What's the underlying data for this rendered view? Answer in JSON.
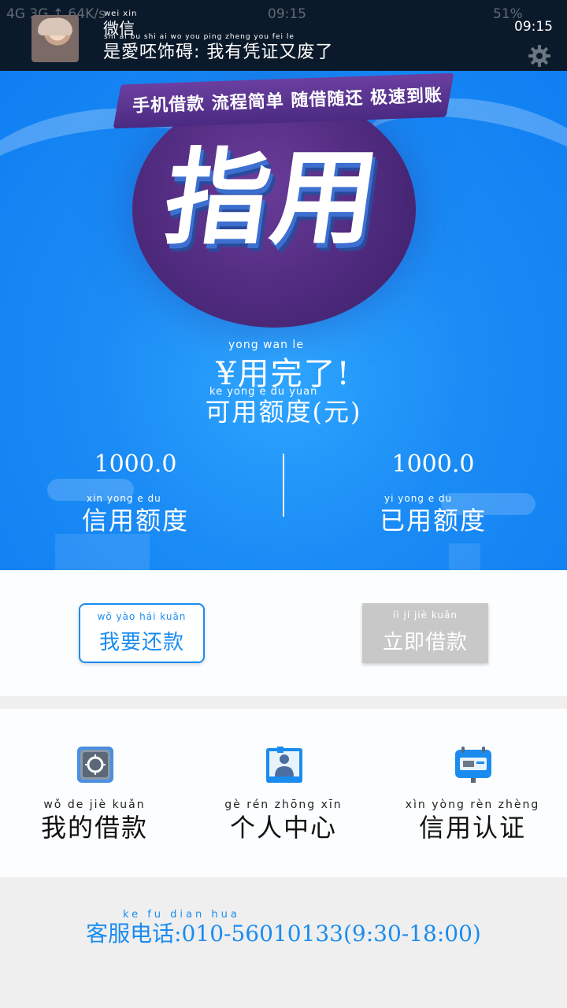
{
  "status_bar": {
    "network": "4G 3G ↑ 64K/s",
    "clock_ghost": "09:15",
    "battery": "51%",
    "time": "09:15"
  },
  "notification": {
    "app_pinyin": "wei  xin",
    "app": "微信",
    "message_pinyin": "shi   ai    bu   shi   ai     wo   you  ping zheng you  fei    le",
    "message": "是愛呸饰碍: 我有凭证又废了"
  },
  "hero": {
    "banner_text": "手机借款 流程简单 随借随还 极速到账",
    "brand": "指用",
    "amount_pinyin": "yong  wan    le",
    "amount": "¥用完了!",
    "amount_label_pinyin": "ke   yong   e   du   yuan",
    "amount_label": "可用额度(元)",
    "credit_limit_value": "1000.0",
    "credit_limit_pinyin": "xin  yong   e   du",
    "credit_limit_label": "信用额度",
    "used_limit_value": "1000.0",
    "used_limit_pinyin": "yi   yong   e   du",
    "used_limit_label": "已用额度"
  },
  "actions": {
    "repay_pinyin": "wǒ  yào  hái  kuǎn",
    "repay_label": "我要还款",
    "borrow_pinyin": "lì    jí    jiè  kuǎn",
    "borrow_label": "立即借款"
  },
  "menu": [
    {
      "pinyin": "wǒ  de  jiè  kuǎn",
      "label": "我的借款",
      "icon": "safe-icon"
    },
    {
      "pinyin": "gè  rén zhōng xīn",
      "label": "个人中心",
      "icon": "person-card-icon"
    },
    {
      "pinyin": "xìn yòng rèn zhèng",
      "label": "信用认证",
      "icon": "credit-card-icon"
    }
  ],
  "footer": {
    "phone_pinyin": "ke    fu   dian  hua",
    "phone": "客服电话:010-56010133(9:30-18:00)"
  },
  "colors": {
    "accent": "#1a8cf0",
    "hero_blue": "#1b8cf5",
    "disabled_button": "#c8c8c8",
    "notification_bg": "#0b1a2a"
  }
}
